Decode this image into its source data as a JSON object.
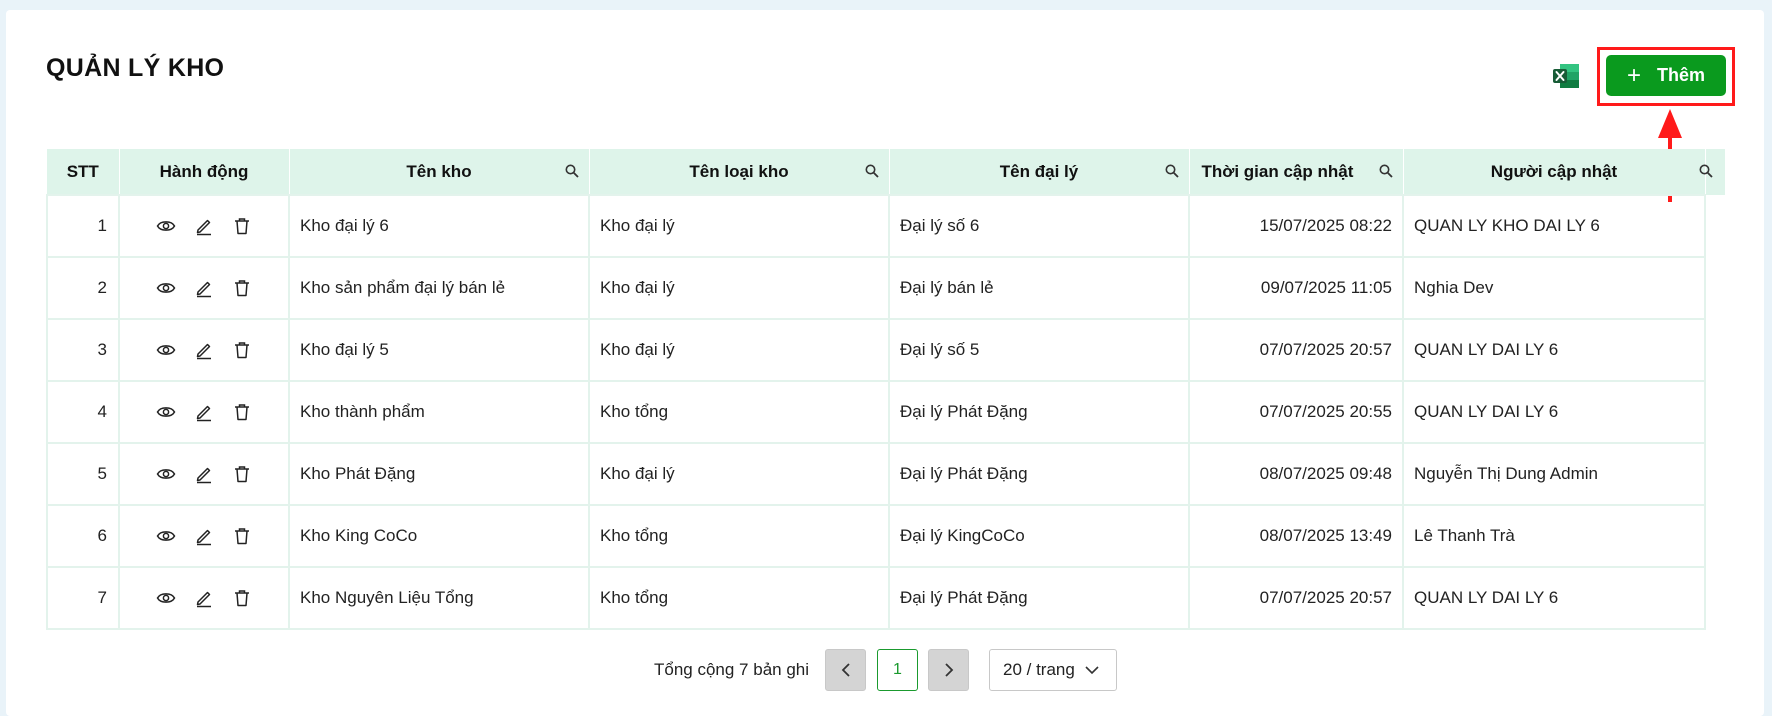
{
  "page": {
    "title": "QUẢN LÝ KHO",
    "add_label": "Thêm",
    "excel_icon": "excel-icon",
    "highlight_color": "#ff1a1a",
    "accent": "#0a9a1e"
  },
  "table": {
    "columns": {
      "stt": "STT",
      "actions": "Hành động",
      "warehouse_name": "Tên kho",
      "warehouse_type": "Tên loại kho",
      "agent_name": "Tên đại lý",
      "updated_at": "Thời gian cập nhật",
      "updated_by": "Người cập nhật"
    },
    "rows": [
      {
        "stt": "1",
        "warehouse_name": "Kho đại lý 6",
        "warehouse_type": "Kho đại lý",
        "agent_name": "Đại lý số 6",
        "updated_at": "15/07/2025 08:22",
        "updated_by": "QUAN LY KHO DAI LY 6"
      },
      {
        "stt": "2",
        "warehouse_name": "Kho sản phẩm đại lý bán lẻ",
        "warehouse_type": "Kho đại lý",
        "agent_name": "Đại lý bán lẻ",
        "updated_at": "09/07/2025 11:05",
        "updated_by": "Nghia Dev"
      },
      {
        "stt": "3",
        "warehouse_name": "Kho đại lý 5",
        "warehouse_type": "Kho đại lý",
        "agent_name": "Đại lý số 5",
        "updated_at": "07/07/2025 20:57",
        "updated_by": "QUAN LY DAI LY 6"
      },
      {
        "stt": "4",
        "warehouse_name": "Kho thành phẩm",
        "warehouse_type": "Kho tổng",
        "agent_name": "Đại lý Phát Đặng",
        "updated_at": "07/07/2025 20:55",
        "updated_by": "QUAN LY DAI LY 6"
      },
      {
        "stt": "5",
        "warehouse_name": "Kho Phát Đặng",
        "warehouse_type": "Kho đại lý",
        "agent_name": "Đại lý Phát Đặng",
        "updated_at": "08/07/2025 09:48",
        "updated_by": "Nguyễn Thị Dung Admin"
      },
      {
        "stt": "6",
        "warehouse_name": "Kho King CoCo",
        "warehouse_type": "Kho tổng",
        "agent_name": "Đại lý KingCoCo",
        "updated_at": "08/07/2025 13:49",
        "updated_by": "Lê Thanh Trà"
      },
      {
        "stt": "7",
        "warehouse_name": "Kho Nguyên Liệu Tổng",
        "warehouse_type": "Kho tổng",
        "agent_name": "Đại lý Phát Đặng",
        "updated_at": "07/07/2025 20:57",
        "updated_by": "QUAN LY DAI LY 6"
      }
    ]
  },
  "pagination": {
    "total_text": "Tổng cộng 7 bản ghi",
    "current_page": "1",
    "page_size": "20 / trang"
  }
}
